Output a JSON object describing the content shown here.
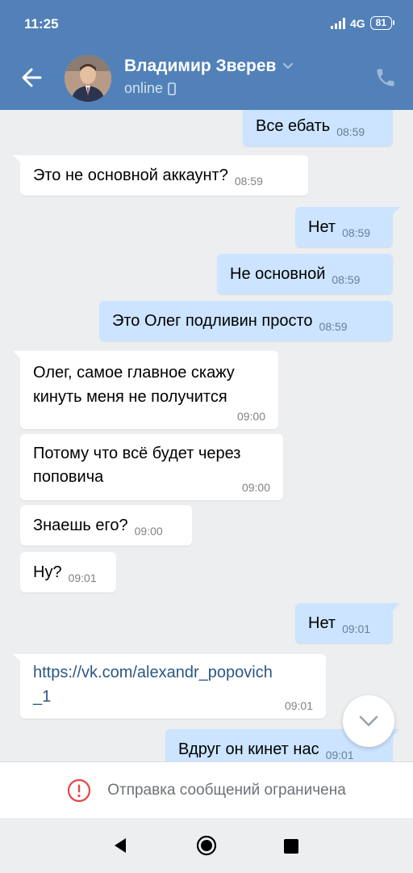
{
  "status_bar": {
    "time": "11:25",
    "network": "4G",
    "battery": "81"
  },
  "header": {
    "contact_name": "Владимир Зверев",
    "status": "online",
    "colors": {
      "bar": "#5181b8"
    }
  },
  "messages": [
    {
      "dir": "out",
      "text": "Все ебать",
      "time": "08:59"
    },
    {
      "dir": "in",
      "text": "Это не основной аккаунт?",
      "time": "08:59"
    },
    {
      "dir": "out",
      "text": "Нет",
      "time": "08:59"
    },
    {
      "dir": "out",
      "text": "Не основной",
      "time": "08:59"
    },
    {
      "dir": "out",
      "text": "Это Олег подливин просто",
      "time": "08:59"
    },
    {
      "dir": "in",
      "line1": "Олег, самое главное скажу",
      "line2": "кинуть меня не получится",
      "time": "09:00"
    },
    {
      "dir": "in",
      "line1": "Потому что всё будет через",
      "line2": "поповича",
      "time": "09:00"
    },
    {
      "dir": "in",
      "text": "Знаешь его?",
      "time": "09:00"
    },
    {
      "dir": "in",
      "text": "Ну?",
      "time": "09:01"
    },
    {
      "dir": "out",
      "text": "Нет",
      "time": "09:01"
    },
    {
      "dir": "in",
      "line1": "https://vk.com/alexandr_popovich",
      "line2": "_1",
      "time": "09:01"
    },
    {
      "dir": "out",
      "text": "Вдруг он кинет нас",
      "time": "09:01"
    }
  ],
  "restriction": {
    "text": "Отправка сообщений ограничена",
    "icon": "alert-circle-icon",
    "color": "#e64646"
  },
  "colors": {
    "background": "#edeef0",
    "outgoing_bubble": "#cce4ff",
    "incoming_bubble": "#ffffff",
    "link": "#2a5885"
  }
}
